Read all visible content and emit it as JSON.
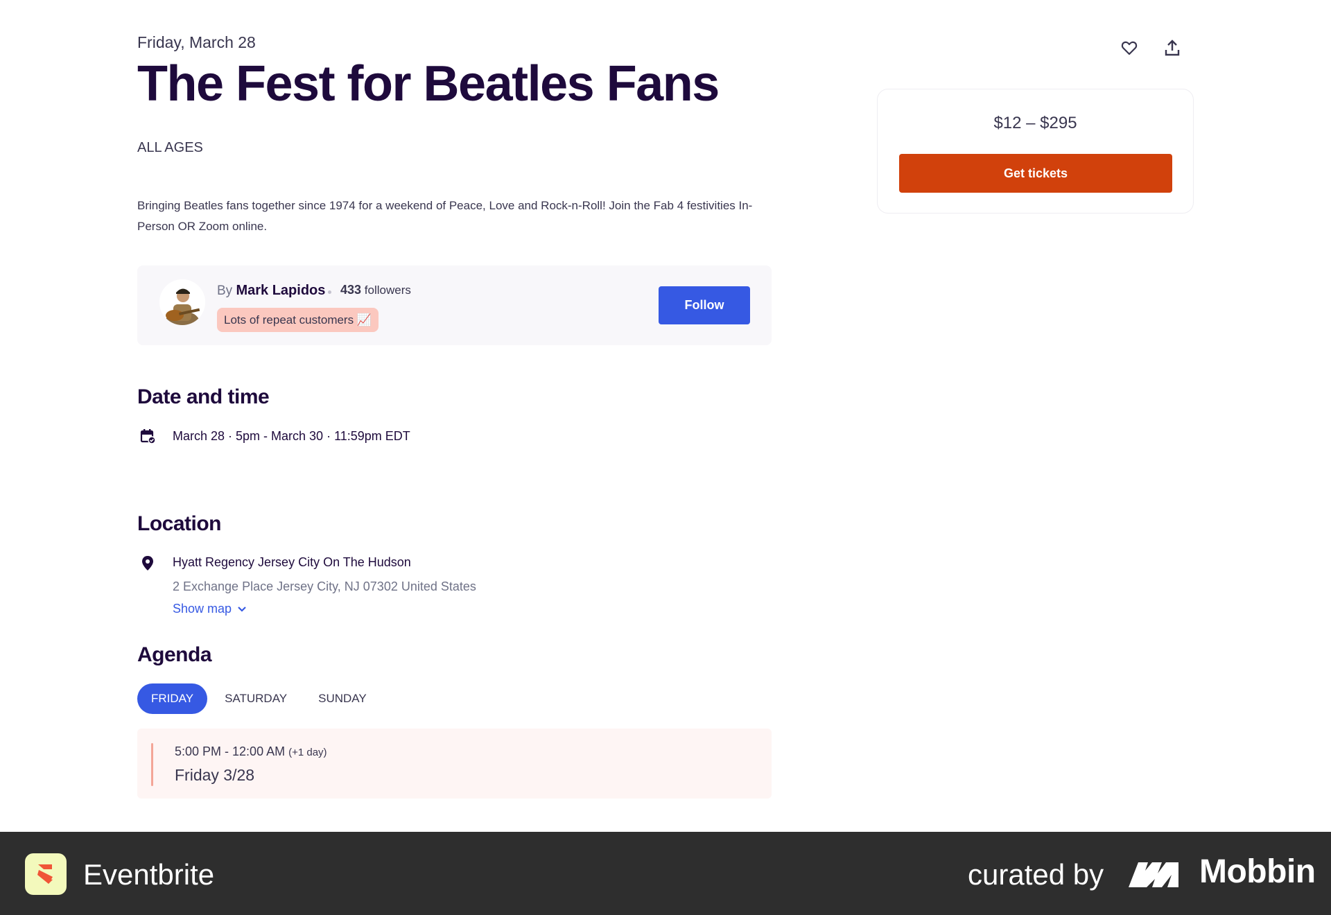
{
  "event": {
    "date_line": "Friday, March 28",
    "title": "The Fest for Beatles Fans",
    "age_restriction": "ALL AGES",
    "summary": "Bringing Beatles fans together since 1974 for a weekend of Peace, Love and Rock-n-Roll! Join the Fab 4 festivities In-Person OR Zoom online."
  },
  "organizer": {
    "by_label": "By",
    "name": "Mark Lapidos",
    "followers_count": "433",
    "followers_label": "followers",
    "badge": "Lots of repeat customers 📈",
    "follow_label": "Follow"
  },
  "date_time": {
    "heading": "Date and time",
    "value": "March 28 · 5pm - March 30 · 11:59pm EDT"
  },
  "location": {
    "heading": "Location",
    "venue": "Hyatt Regency Jersey City On The Hudson",
    "address": "2 Exchange Place Jersey City, NJ 07302 United States",
    "show_map_label": "Show map"
  },
  "agenda": {
    "heading": "Agenda",
    "tabs": [
      {
        "label": "FRIDAY",
        "active": true
      },
      {
        "label": "SATURDAY",
        "active": false
      },
      {
        "label": "SUNDAY",
        "active": false
      }
    ],
    "items": [
      {
        "time": "5:00 PM - 12:00 AM",
        "time_note": "(+1 day)",
        "title": "Friday 3/28"
      }
    ]
  },
  "tickets": {
    "price_range": "$12 – $295",
    "button_label": "Get tickets"
  },
  "icons": {
    "like": "heart-icon",
    "share": "share-icon",
    "calendar": "calendar-icon",
    "location": "location-pin-icon",
    "chevron": "chevron-down-icon"
  },
  "colors": {
    "primary_blue": "#3659e3",
    "ticket_orange": "#d1410c",
    "heading_purple": "#1e0a3c",
    "badge_pink": "#fbc8bf",
    "footer_bg": "#2e2e2e"
  },
  "footer": {
    "app_name": "Eventbrite",
    "curated_by": "curated by",
    "brand": "Mobbin"
  }
}
